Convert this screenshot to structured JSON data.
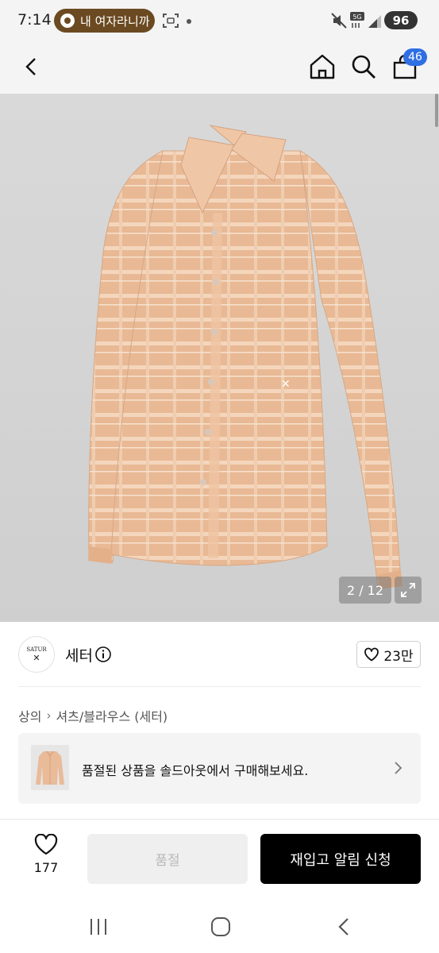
{
  "status_bar": {
    "time": "7:14",
    "notification": "내 여자라니까",
    "network": "5G",
    "battery": "96"
  },
  "nav": {
    "cart_count": "46"
  },
  "gallery": {
    "counter": "2 / 12"
  },
  "brand": {
    "logo_text": "SATUR",
    "name": "세터",
    "likes": "23만"
  },
  "breadcrumb": [
    "상의",
    "셔츠/블라우스 (세터)"
  ],
  "soldout_banner": {
    "text": "품절된 상품을 솔드아웃에서 구매해보세요."
  },
  "actions": {
    "wishlist_count": "177",
    "soldout_label": "품절",
    "restock_label": "재입고 알림 신청"
  },
  "colors": {
    "accent_badge": "#2f6fe4",
    "notification_pill": "#6b4a21",
    "shirt": "#e9bb99"
  }
}
